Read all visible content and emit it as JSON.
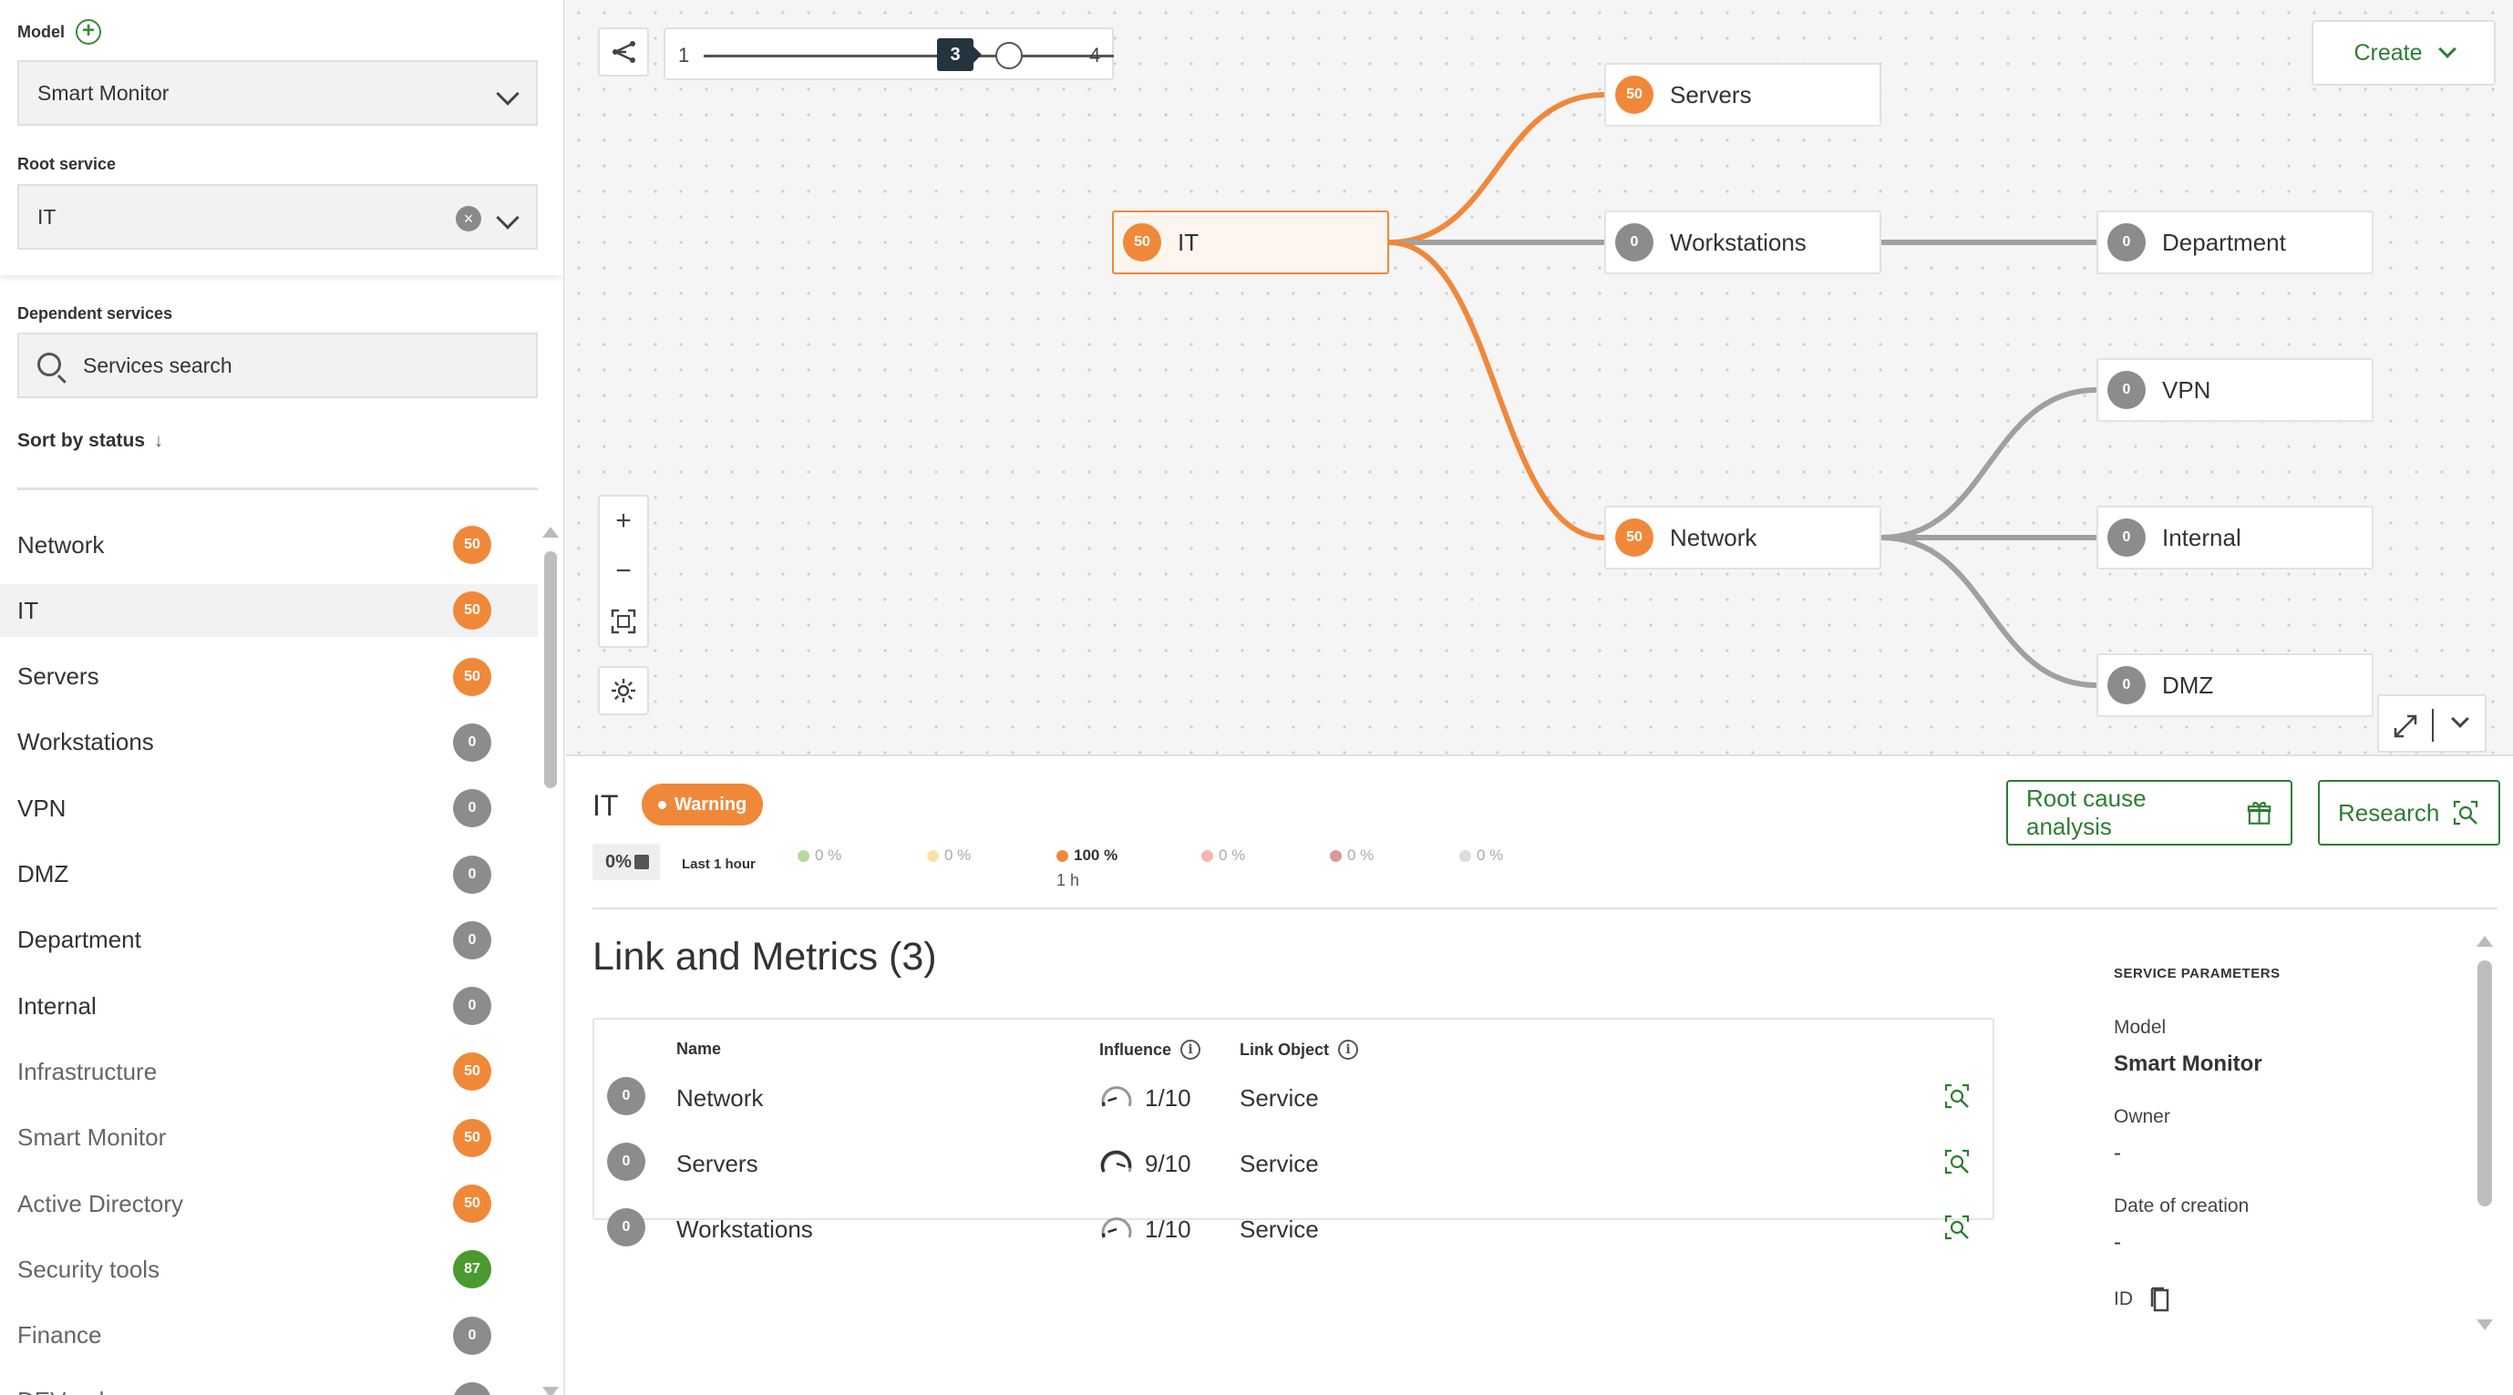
{
  "sidebar": {
    "model_label": "Model",
    "model_value": "Smart Monitor",
    "root_service_label": "Root service",
    "root_service_value": "IT",
    "dependent_label": "Dependent services",
    "search_placeholder": "Services search",
    "sort_label": "Sort by status",
    "services": [
      {
        "name": "Network",
        "status": "50",
        "color": "#f0883a"
      },
      {
        "name": "IT",
        "status": "50",
        "color": "#f0883a"
      },
      {
        "name": "Servers",
        "status": "50",
        "color": "#f0883a"
      },
      {
        "name": "Workstations",
        "status": "0",
        "color": "#8c8c8c"
      },
      {
        "name": "VPN",
        "status": "0",
        "color": "#8c8c8c"
      },
      {
        "name": "DMZ",
        "status": "0",
        "color": "#8c8c8c"
      },
      {
        "name": "Department",
        "status": "0",
        "color": "#8c8c8c"
      },
      {
        "name": "Internal",
        "status": "0",
        "color": "#8c8c8c"
      },
      {
        "name": "Infrastructure",
        "status": "50",
        "color": "#f0883a"
      },
      {
        "name": "Smart Monitor",
        "status": "50",
        "color": "#f0883a"
      },
      {
        "name": "Active Directory",
        "status": "50",
        "color": "#f0883a"
      },
      {
        "name": "Security tools",
        "status": "87",
        "color": "#4b9a2f"
      },
      {
        "name": "Finance",
        "status": "0",
        "color": "#8c8c8c"
      },
      {
        "name": "DEV polygon",
        "status": "0",
        "color": "#8c8c8c"
      }
    ]
  },
  "toolbar": {
    "depth_min": "1",
    "depth_max": "4",
    "depth_value": "3",
    "create_label": "Create"
  },
  "graph": {
    "nodes": [
      {
        "id": "it",
        "label": "IT",
        "status": "50",
        "color": "#f0883a",
        "selected": true
      },
      {
        "id": "servers",
        "label": "Servers",
        "status": "50",
        "color": "#f0883a"
      },
      {
        "id": "workstations",
        "label": "Workstations",
        "status": "0",
        "color": "#8c8c8c"
      },
      {
        "id": "network",
        "label": "Network",
        "status": "50",
        "color": "#f0883a"
      },
      {
        "id": "department",
        "label": "Department",
        "status": "0",
        "color": "#8c8c8c"
      },
      {
        "id": "vpn",
        "label": "VPN",
        "status": "0",
        "color": "#8c8c8c"
      },
      {
        "id": "internal",
        "label": "Internal",
        "status": "0",
        "color": "#8c8c8c"
      },
      {
        "id": "dmz",
        "label": "DMZ",
        "status": "0",
        "color": "#8c8c8c"
      }
    ],
    "edges": [
      {
        "from": "it",
        "to": "servers",
        "color": "#f0883a"
      },
      {
        "from": "it",
        "to": "workstations",
        "color": "#a0a0a0"
      },
      {
        "from": "it",
        "to": "network",
        "color": "#f0883a"
      },
      {
        "from": "workstations",
        "to": "department",
        "color": "#a0a0a0"
      },
      {
        "from": "network",
        "to": "vpn",
        "color": "#a0a0a0"
      },
      {
        "from": "network",
        "to": "internal",
        "color": "#a0a0a0"
      },
      {
        "from": "network",
        "to": "dmz",
        "color": "#a0a0a0"
      }
    ]
  },
  "detail": {
    "title": "IT",
    "status_label": "Warning",
    "status_color": "#f0883a",
    "current_pct": "0%",
    "period_label": "Last 1 hour",
    "distribution": [
      {
        "label": "0 %",
        "color": "#b5d9a0",
        "sub": ""
      },
      {
        "label": "0 %",
        "color": "#f5e3a8",
        "sub": ""
      },
      {
        "label": "100 %",
        "color": "#f0883a",
        "sub": "1 h",
        "strong": true
      },
      {
        "label": "0 %",
        "color": "#f3b8b0",
        "sub": ""
      },
      {
        "label": "0 %",
        "color": "#d99a9a",
        "sub": ""
      },
      {
        "label": "0 %",
        "color": "#dddddd",
        "sub": ""
      }
    ],
    "rca_label": "Root cause analysis",
    "research_label": "Research",
    "links_title": "Link and Metrics (3)",
    "columns": {
      "name": "Name",
      "influence": "Influence",
      "link_object": "Link Object"
    },
    "rows": [
      {
        "status": "0",
        "name": "Network",
        "influence": "1/10",
        "influence_level": 0.1,
        "link_object": "Service"
      },
      {
        "status": "0",
        "name": "Servers",
        "influence": "9/10",
        "influence_level": 0.9,
        "link_object": "Service"
      },
      {
        "status": "0",
        "name": "Workstations",
        "influence": "1/10",
        "influence_level": 0.1,
        "link_object": "Service"
      }
    ],
    "params": {
      "heading": "SERVICE PARAMETERS",
      "model_label": "Model",
      "model_value": "Smart Monitor",
      "owner_label": "Owner",
      "owner_value": "-",
      "date_label": "Date of creation",
      "date_value": "-",
      "id_label": "ID"
    }
  }
}
